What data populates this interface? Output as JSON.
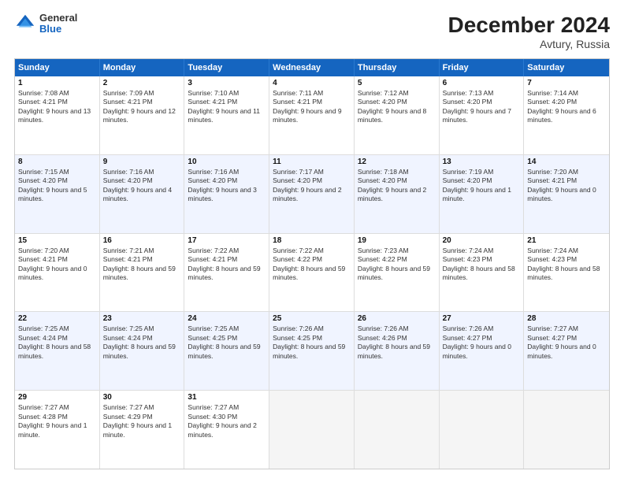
{
  "header": {
    "logo_line1": "General",
    "logo_line2": "Blue",
    "title": "December 2024",
    "subtitle": "Avtury, Russia"
  },
  "days": [
    "Sunday",
    "Monday",
    "Tuesday",
    "Wednesday",
    "Thursday",
    "Friday",
    "Saturday"
  ],
  "weeks": [
    [
      {
        "day": "1",
        "sunrise": "7:08 AM",
        "sunset": "4:21 PM",
        "daylight": "9 hours and 13 minutes."
      },
      {
        "day": "2",
        "sunrise": "7:09 AM",
        "sunset": "4:21 PM",
        "daylight": "9 hours and 12 minutes."
      },
      {
        "day": "3",
        "sunrise": "7:10 AM",
        "sunset": "4:21 PM",
        "daylight": "9 hours and 11 minutes."
      },
      {
        "day": "4",
        "sunrise": "7:11 AM",
        "sunset": "4:21 PM",
        "daylight": "9 hours and 9 minutes."
      },
      {
        "day": "5",
        "sunrise": "7:12 AM",
        "sunset": "4:20 PM",
        "daylight": "9 hours and 8 minutes."
      },
      {
        "day": "6",
        "sunrise": "7:13 AM",
        "sunset": "4:20 PM",
        "daylight": "9 hours and 7 minutes."
      },
      {
        "day": "7",
        "sunrise": "7:14 AM",
        "sunset": "4:20 PM",
        "daylight": "9 hours and 6 minutes."
      }
    ],
    [
      {
        "day": "8",
        "sunrise": "7:15 AM",
        "sunset": "4:20 PM",
        "daylight": "9 hours and 5 minutes."
      },
      {
        "day": "9",
        "sunrise": "7:16 AM",
        "sunset": "4:20 PM",
        "daylight": "9 hours and 4 minutes."
      },
      {
        "day": "10",
        "sunrise": "7:16 AM",
        "sunset": "4:20 PM",
        "daylight": "9 hours and 3 minutes."
      },
      {
        "day": "11",
        "sunrise": "7:17 AM",
        "sunset": "4:20 PM",
        "daylight": "9 hours and 2 minutes."
      },
      {
        "day": "12",
        "sunrise": "7:18 AM",
        "sunset": "4:20 PM",
        "daylight": "9 hours and 2 minutes."
      },
      {
        "day": "13",
        "sunrise": "7:19 AM",
        "sunset": "4:20 PM",
        "daylight": "9 hours and 1 minute."
      },
      {
        "day": "14",
        "sunrise": "7:20 AM",
        "sunset": "4:21 PM",
        "daylight": "9 hours and 0 minutes."
      }
    ],
    [
      {
        "day": "15",
        "sunrise": "7:20 AM",
        "sunset": "4:21 PM",
        "daylight": "9 hours and 0 minutes."
      },
      {
        "day": "16",
        "sunrise": "7:21 AM",
        "sunset": "4:21 PM",
        "daylight": "8 hours and 59 minutes."
      },
      {
        "day": "17",
        "sunrise": "7:22 AM",
        "sunset": "4:21 PM",
        "daylight": "8 hours and 59 minutes."
      },
      {
        "day": "18",
        "sunrise": "7:22 AM",
        "sunset": "4:22 PM",
        "daylight": "8 hours and 59 minutes."
      },
      {
        "day": "19",
        "sunrise": "7:23 AM",
        "sunset": "4:22 PM",
        "daylight": "8 hours and 59 minutes."
      },
      {
        "day": "20",
        "sunrise": "7:24 AM",
        "sunset": "4:23 PM",
        "daylight": "8 hours and 58 minutes."
      },
      {
        "day": "21",
        "sunrise": "7:24 AM",
        "sunset": "4:23 PM",
        "daylight": "8 hours and 58 minutes."
      }
    ],
    [
      {
        "day": "22",
        "sunrise": "7:25 AM",
        "sunset": "4:24 PM",
        "daylight": "8 hours and 58 minutes."
      },
      {
        "day": "23",
        "sunrise": "7:25 AM",
        "sunset": "4:24 PM",
        "daylight": "8 hours and 59 minutes."
      },
      {
        "day": "24",
        "sunrise": "7:25 AM",
        "sunset": "4:25 PM",
        "daylight": "8 hours and 59 minutes."
      },
      {
        "day": "25",
        "sunrise": "7:26 AM",
        "sunset": "4:25 PM",
        "daylight": "8 hours and 59 minutes."
      },
      {
        "day": "26",
        "sunrise": "7:26 AM",
        "sunset": "4:26 PM",
        "daylight": "8 hours and 59 minutes."
      },
      {
        "day": "27",
        "sunrise": "7:26 AM",
        "sunset": "4:27 PM",
        "daylight": "9 hours and 0 minutes."
      },
      {
        "day": "28",
        "sunrise": "7:27 AM",
        "sunset": "4:27 PM",
        "daylight": "9 hours and 0 minutes."
      }
    ],
    [
      {
        "day": "29",
        "sunrise": "7:27 AM",
        "sunset": "4:28 PM",
        "daylight": "9 hours and 1 minute."
      },
      {
        "day": "30",
        "sunrise": "7:27 AM",
        "sunset": "4:29 PM",
        "daylight": "9 hours and 1 minute."
      },
      {
        "day": "31",
        "sunrise": "7:27 AM",
        "sunset": "4:30 PM",
        "daylight": "9 hours and 2 minutes."
      },
      null,
      null,
      null,
      null
    ]
  ]
}
